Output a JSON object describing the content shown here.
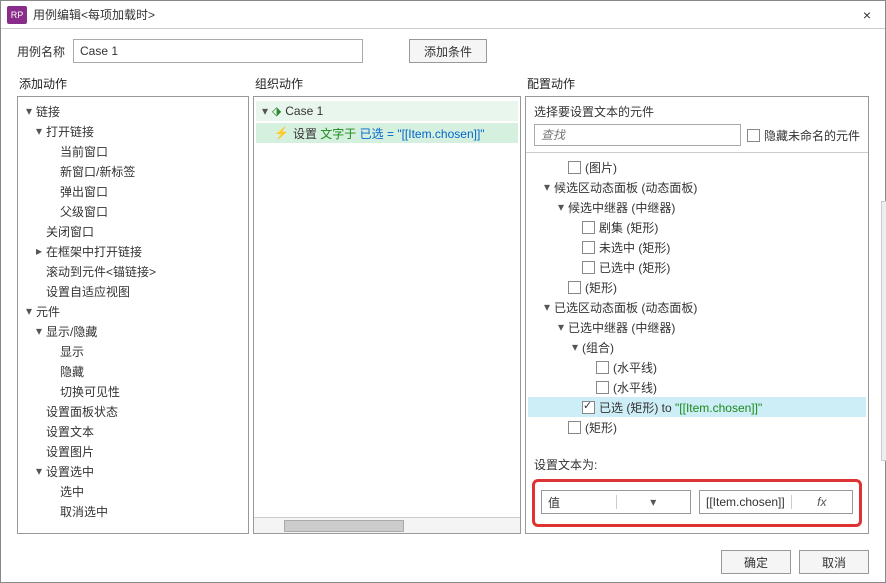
{
  "window": {
    "title": "用例编辑<每项加载时>",
    "close": "×"
  },
  "caseName": {
    "label": "用例名称",
    "value": "Case 1"
  },
  "addCondition": "添加条件",
  "columns": {
    "c1": "添加动作",
    "c2": "组织动作",
    "c3": "配置动作"
  },
  "addActions": [
    {
      "t": "链接",
      "lvl": 0,
      "exp": "▾"
    },
    {
      "t": "打开链接",
      "lvl": 1,
      "exp": "▾"
    },
    {
      "t": "当前窗口",
      "lvl": 2
    },
    {
      "t": "新窗口/新标签",
      "lvl": 2
    },
    {
      "t": "弹出窗口",
      "lvl": 2
    },
    {
      "t": "父级窗口",
      "lvl": 2
    },
    {
      "t": "关闭窗口",
      "lvl": 1
    },
    {
      "t": "在框架中打开链接",
      "lvl": 1,
      "exp": "▸"
    },
    {
      "t": "滚动到元件<锚链接>",
      "lvl": 1
    },
    {
      "t": "设置自适应视图",
      "lvl": 1
    },
    {
      "t": "元件",
      "lvl": 0,
      "exp": "▾"
    },
    {
      "t": "显示/隐藏",
      "lvl": 1,
      "exp": "▾"
    },
    {
      "t": "显示",
      "lvl": 2
    },
    {
      "t": "隐藏",
      "lvl": 2
    },
    {
      "t": "切换可见性",
      "lvl": 2
    },
    {
      "t": "设置面板状态",
      "lvl": 1
    },
    {
      "t": "设置文本",
      "lvl": 1
    },
    {
      "t": "设置图片",
      "lvl": 1
    },
    {
      "t": "设置选中",
      "lvl": 1,
      "exp": "▾"
    },
    {
      "t": "选中",
      "lvl": 2
    },
    {
      "t": "取消选中",
      "lvl": 2
    }
  ],
  "org": {
    "case": "Case 1",
    "actionPrefix": "设置 ",
    "actionMid": "文字于 ",
    "actionSuffix": "已选 = \"[[Item.chosen]]\""
  },
  "config": {
    "header": "选择要设置文本的元件",
    "searchPlaceholder": "查找",
    "hideUnnamed": "隐藏未命名的元件",
    "tree": [
      {
        "lvl": 2,
        "chk": 0,
        "t": "(图片)"
      },
      {
        "lvl": 1,
        "exp": "▾",
        "t": "候选区动态面板 (动态面板)"
      },
      {
        "lvl": 2,
        "exp": "▾",
        "t": "候选中继器 (中继器)"
      },
      {
        "lvl": 3,
        "chk": 0,
        "t": "剧集 (矩形)"
      },
      {
        "lvl": 3,
        "chk": 0,
        "t": "未选中 (矩形)"
      },
      {
        "lvl": 3,
        "chk": 0,
        "t": "已选中 (矩形)"
      },
      {
        "lvl": 2,
        "chk": 0,
        "t": "(矩形)"
      },
      {
        "lvl": 1,
        "exp": "▾",
        "t": "已选区动态面板 (动态面板)"
      },
      {
        "lvl": 2,
        "exp": "▾",
        "t": "已选中继器 (中继器)"
      },
      {
        "lvl": 3,
        "exp": "▾",
        "t": "(组合)"
      },
      {
        "lvl": 4,
        "chk": 0,
        "t": "(水平线)"
      },
      {
        "lvl": 4,
        "chk": 0,
        "t": "(水平线)"
      },
      {
        "lvl": 3,
        "chk": 1,
        "sel": 1,
        "pre": "已选 (矩形) to ",
        "val": "\"[[Item.chosen]]\""
      },
      {
        "lvl": 2,
        "chk": 0,
        "t": "(矩形)"
      }
    ],
    "setTextLabel": "设置文本为:",
    "dropdown": "值",
    "valueExpr": "[[Item.chosen]]",
    "fx": "fx"
  },
  "footer": {
    "ok": "确定",
    "cancel": "取消"
  }
}
